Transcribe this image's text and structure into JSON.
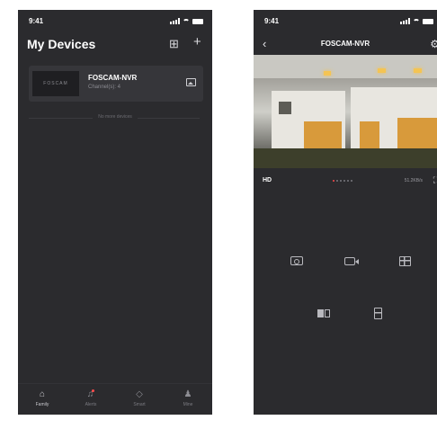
{
  "left_screen": {
    "status_bar": {
      "time": "9:41"
    },
    "header": {
      "title": "My Devices",
      "icons": [
        "grid-icon",
        "plus-icon"
      ]
    },
    "device_card": {
      "thumbnail_text": "FOSCAM",
      "name": "FOSCAM-NVR",
      "subtitle": "Channel(s): 4",
      "icon": "image-icon"
    },
    "no_more_text": "No more devices",
    "tab_bar": [
      {
        "label": "Family",
        "icon": "home-icon",
        "active": true
      },
      {
        "label": "Alerts",
        "icon": "bell-icon",
        "badge": true
      },
      {
        "label": "Smart",
        "icon": "smart-icon"
      },
      {
        "label": "Mine",
        "icon": "person-icon"
      }
    ]
  },
  "right_screen": {
    "status_bar": {
      "time": "9:41"
    },
    "nav": {
      "title": "FOSCAM-NVR",
      "back_icon": "chevron-left-icon",
      "settings_icon": "gear-icon"
    },
    "video_controls": {
      "quality": "HD",
      "page_count": 6,
      "active_page": 0,
      "bitrate": "51.2KB/s",
      "fullscreen_icon": "fullscreen-icon"
    },
    "controls": [
      {
        "name": "snapshot",
        "icon": "camera-icon"
      },
      {
        "name": "record",
        "icon": "video-record-icon"
      },
      {
        "name": "multi-view",
        "icon": "grid-icon"
      },
      {
        "name": "split-view",
        "icon": "split-screen-icon"
      },
      {
        "name": "ptz",
        "icon": "ptz-icon"
      }
    ]
  },
  "colors": {
    "background": "#2b2b2e",
    "card": "#36363a",
    "accent_red": "#ff4b4b",
    "light_glow": "#f4c453"
  }
}
